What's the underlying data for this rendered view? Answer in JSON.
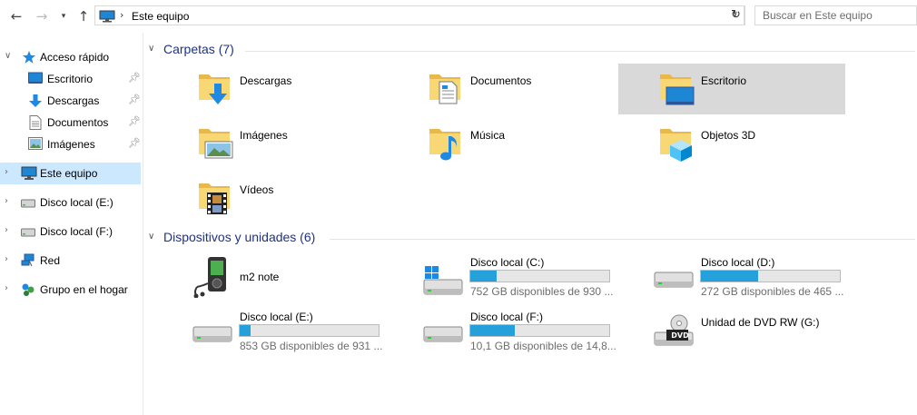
{
  "address_bar": {
    "path": "Este equipo",
    "search_placeholder": "Buscar en Este equipo"
  },
  "sidebar": {
    "items": [
      {
        "label": "Acceso rápido",
        "icon": "star-icon"
      },
      {
        "label": "Escritorio",
        "icon": "desktop-icon",
        "pinned": true
      },
      {
        "label": "Descargas",
        "icon": "download-arrow-icon",
        "pinned": true
      },
      {
        "label": "Documentos",
        "icon": "document-icon",
        "pinned": true
      },
      {
        "label": "Imágenes",
        "icon": "picture-icon",
        "pinned": true
      },
      {
        "label": "Este equipo",
        "icon": "computer-icon",
        "selected": true
      },
      {
        "label": "Disco local (E:)",
        "icon": "drive-icon"
      },
      {
        "label": "Disco local (F:)",
        "icon": "drive-icon"
      },
      {
        "label": "Red",
        "icon": "network-icon"
      },
      {
        "label": "Grupo en el hogar",
        "icon": "homegroup-icon"
      }
    ]
  },
  "folders_section": {
    "title": "Carpetas (7)",
    "items": [
      {
        "name": "Descargas",
        "icon": "downloads-folder-icon"
      },
      {
        "name": "Documentos",
        "icon": "documents-folder-icon"
      },
      {
        "name": "Escritorio",
        "icon": "desktop-folder-icon",
        "selected": true
      },
      {
        "name": "Imágenes",
        "icon": "pictures-folder-icon"
      },
      {
        "name": "Música",
        "icon": "music-folder-icon"
      },
      {
        "name": "Objetos 3D",
        "icon": "3d-objects-folder-icon"
      },
      {
        "name": "Vídeos",
        "icon": "videos-folder-icon"
      }
    ]
  },
  "devices_section": {
    "title": "Dispositivos y unidades (6)",
    "items": [
      {
        "name": "m2 note",
        "icon": "media-player-icon",
        "type": "device"
      },
      {
        "name": "Disco local (C:)",
        "icon": "windows-drive-icon",
        "free": "752 GB disponibles de 930 ...",
        "used_fraction": 0.19
      },
      {
        "name": "Disco local (D:)",
        "icon": "drive-icon",
        "free": "272 GB disponibles de 465 ...",
        "used_fraction": 0.41
      },
      {
        "name": "Disco local (E:)",
        "icon": "drive-icon",
        "free": "853 GB disponibles de 931 ...",
        "used_fraction": 0.08
      },
      {
        "name": "Disco local (F:)",
        "icon": "drive-icon",
        "free": "10,1 GB disponibles de 14,8...",
        "used_fraction": 0.32
      },
      {
        "name": "Unidad de DVD RW (G:)",
        "icon": "dvd-drive-icon",
        "type": "dvd",
        "badge": "DVD"
      }
    ]
  },
  "colors": {
    "accent": "#26a0da",
    "selection": "#cce8ff",
    "section_title": "#1e3287",
    "folder": "#f8d775"
  }
}
